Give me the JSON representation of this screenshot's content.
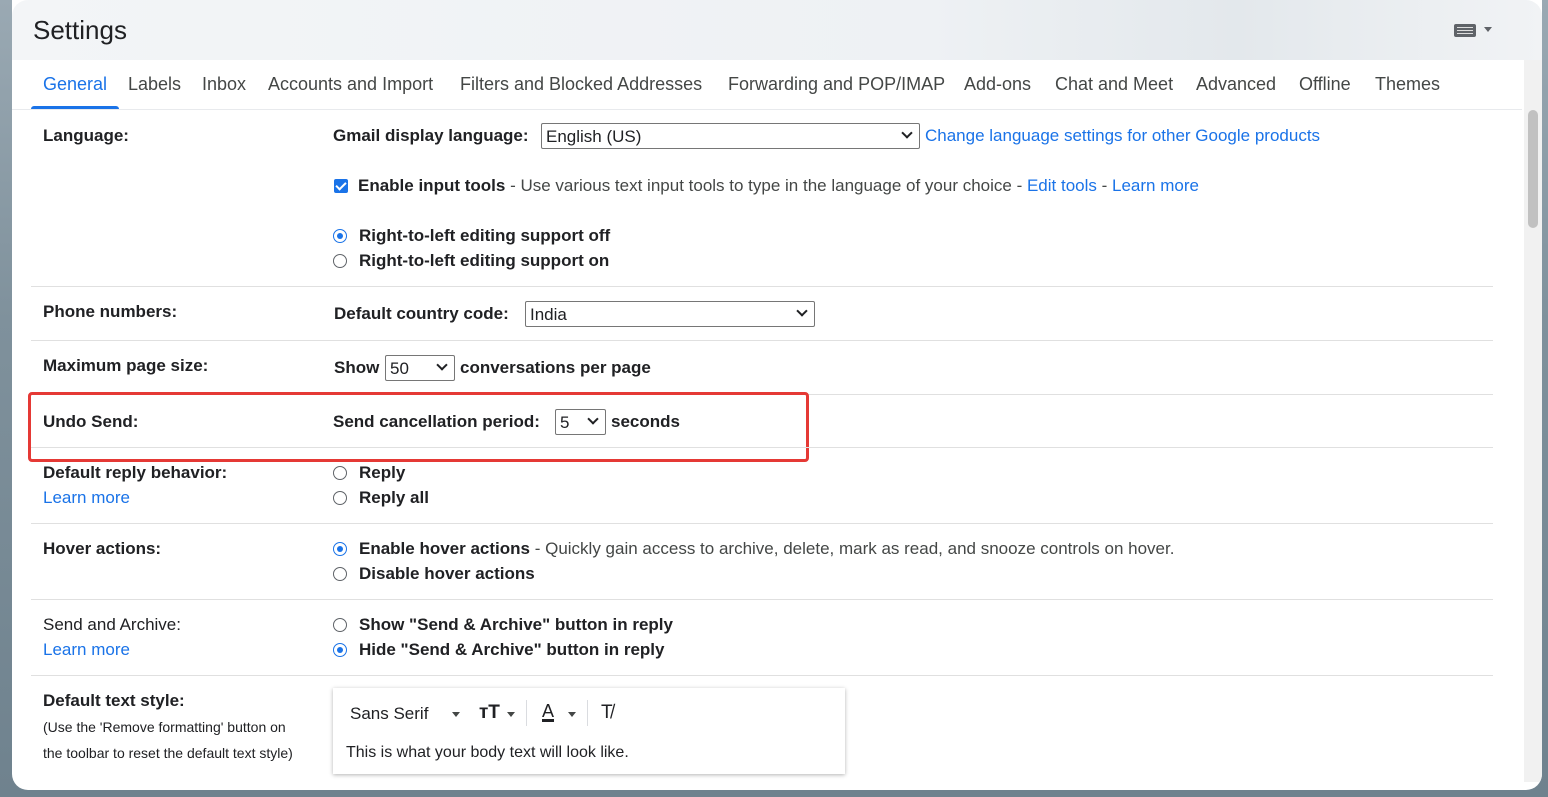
{
  "header": {
    "title": "Settings"
  },
  "tabs": [
    {
      "label": "General",
      "active": true
    },
    {
      "label": "Labels"
    },
    {
      "label": "Inbox"
    },
    {
      "label": "Accounts and Import"
    },
    {
      "label": "Filters and Blocked Addresses"
    },
    {
      "label": "Forwarding and POP/IMAP"
    },
    {
      "label": "Add-ons"
    },
    {
      "label": "Chat and Meet"
    },
    {
      "label": "Advanced"
    },
    {
      "label": "Offline"
    },
    {
      "label": "Themes"
    }
  ],
  "language": {
    "label": "Language:",
    "display_label": "Gmail display language:",
    "display_value": "English (US)",
    "change_link": "Change language settings for other Google products",
    "input_tools_label": "Enable input tools",
    "input_tools_desc": " - Use various text input tools to type in the language of your choice - ",
    "edit_tools": "Edit tools",
    "dash": " - ",
    "learn_more": "Learn more",
    "rtl_off": "Right-to-left editing support off",
    "rtl_on": "Right-to-left editing support on"
  },
  "phone": {
    "label": "Phone numbers:",
    "country_label": "Default country code:",
    "country_value": "India"
  },
  "page_size": {
    "label": "Maximum page size:",
    "show": "Show",
    "value": "50",
    "suffix": "conversations per page"
  },
  "undo_send": {
    "label": "Undo Send:",
    "period_label": "Send cancellation period:",
    "value": "5",
    "suffix": "seconds"
  },
  "reply": {
    "label": "Default reply behavior:",
    "learn_more": "Learn more",
    "opt1": "Reply",
    "opt2": "Reply all"
  },
  "hover": {
    "label": "Hover actions:",
    "enable": "Enable hover actions",
    "enable_desc": " - Quickly gain access to archive, delete, mark as read, and snooze controls on hover.",
    "disable": "Disable hover actions"
  },
  "send_archive": {
    "label": "Send and Archive:",
    "learn_more": "Learn more",
    "show": "Show \"Send & Archive\" button in reply",
    "hide": "Hide \"Send & Archive\" button in reply"
  },
  "text_style": {
    "label": "Default text style:",
    "note1": "(Use the 'Remove formatting' button on",
    "note2": "the toolbar to reset the default text style)",
    "font": "Sans Serif",
    "size_glyph": "тT",
    "color_glyph": "A",
    "clear_glyph": "T̸",
    "sample": "This is what your body text will look like."
  },
  "colors": {
    "accent": "#1a73e8",
    "highlight": "#e53935"
  }
}
